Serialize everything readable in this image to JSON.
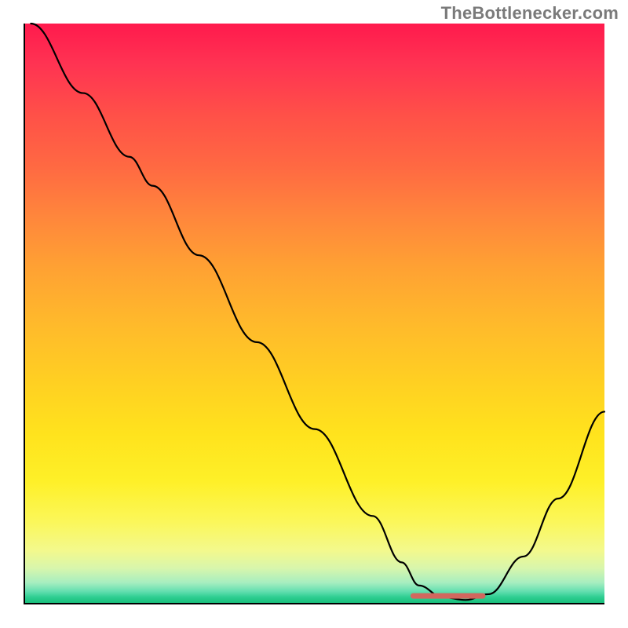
{
  "watermark": "TheBottlenecker.com",
  "chart_data": {
    "type": "line",
    "title": "",
    "xlabel": "",
    "ylabel": "",
    "xlim": [
      0,
      100
    ],
    "ylim": [
      0,
      100
    ],
    "grid": false,
    "series": [
      {
        "name": "bottleneck-curve",
        "x": [
          1,
          10,
          18,
          22,
          30,
          40,
          50,
          60,
          65,
          68,
          72,
          76,
          80,
          86,
          92,
          100
        ],
        "y": [
          100,
          88,
          77,
          72,
          60,
          45,
          30,
          15,
          7,
          3,
          1,
          0.5,
          1.5,
          8,
          18,
          33
        ]
      }
    ],
    "marker": {
      "name": "optimal-band",
      "x_start": 67,
      "x_end": 79,
      "y": 1.2,
      "color": "#d2675e"
    },
    "background_gradient": "red-yellow-green vertical"
  }
}
